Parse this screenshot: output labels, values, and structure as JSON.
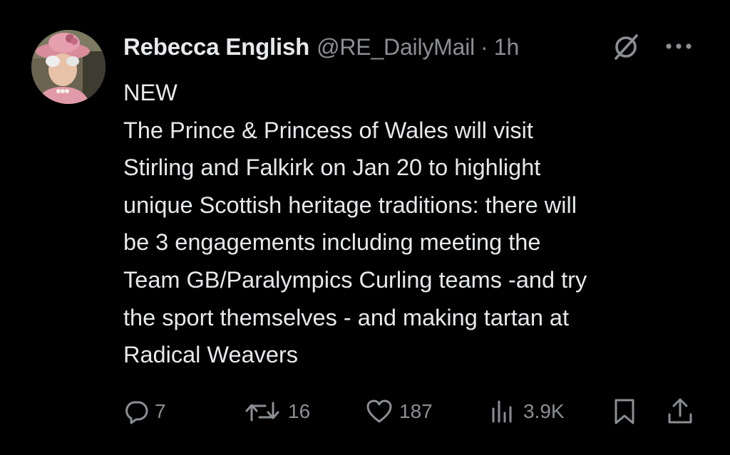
{
  "author": {
    "display_name": "Rebecca English",
    "handle": "@RE_DailyMail",
    "separator": "·",
    "time": "1h"
  },
  "tweet": {
    "lines": [
      "NEW",
      "The Prince & Princess of Wales will visit",
      "Stirling and Falkirk on Jan 20 to highlight",
      "unique Scottish heritage traditions: there will",
      "be 3 engagements including meeting the",
      "Team GB/Paralympics Curling teams -and try",
      "the sport themselves - and making tartan at",
      "Radical Weavers"
    ]
  },
  "actions": {
    "reply": {
      "icon": "reply-icon",
      "count": "7"
    },
    "repost": {
      "icon": "repost-icon",
      "count": "16"
    },
    "like": {
      "icon": "heart-icon",
      "count": "187"
    },
    "views": {
      "icon": "views-icon",
      "count": "3.9K"
    },
    "bookmark": {
      "icon": "bookmark-icon"
    },
    "share": {
      "icon": "share-icon"
    }
  },
  "header_icons": {
    "grok": "grok-icon",
    "more": "more-icon"
  },
  "colors": {
    "background": "#000000",
    "primary_text": "#e7e9ea",
    "secondary_text": "#8b8f94"
  }
}
